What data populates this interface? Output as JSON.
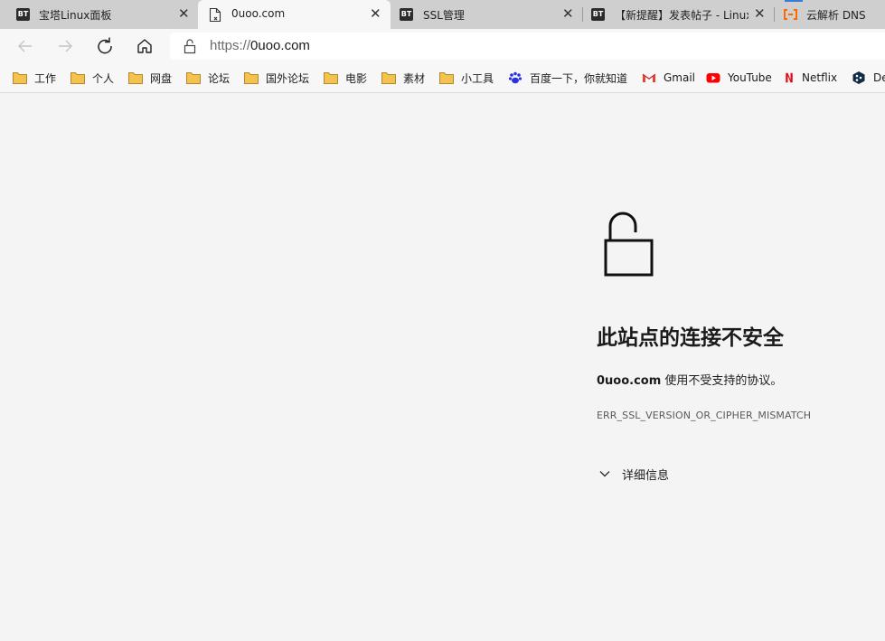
{
  "tabs": [
    {
      "favicon": "BT",
      "title": "宝塔Linux面板",
      "close": "✕"
    },
    {
      "favicon_icon": "broken-page-icon",
      "title": "0uoo.com",
      "close": "✕"
    },
    {
      "favicon": "BT",
      "title": "SSL管理",
      "close": "✕"
    },
    {
      "favicon": "BT",
      "title": "【新提醒】发表帖子 - Linux",
      "close": "✕"
    },
    {
      "favicon_icon": "aliyun-cloud-icon",
      "title": "云解析 DNS"
    }
  ],
  "toolbar": {
    "back_icon": "arrow-left-icon",
    "forward_icon": "arrow-right-icon",
    "refresh_icon": "refresh-icon",
    "home_icon": "home-icon"
  },
  "address_bar": {
    "lock_icon": "unlocked-padlock-icon",
    "url_protocol": "https://",
    "url_host": "0uoo.com"
  },
  "bookmarks": [
    {
      "label": "工作",
      "icon": "folder-icon"
    },
    {
      "label": "个人",
      "icon": "folder-icon"
    },
    {
      "label": "网盘",
      "icon": "folder-icon"
    },
    {
      "label": "论坛",
      "icon": "folder-icon"
    },
    {
      "label": "国外论坛",
      "icon": "folder-icon"
    },
    {
      "label": "电影",
      "icon": "folder-icon"
    },
    {
      "label": "素材",
      "icon": "folder-icon"
    },
    {
      "label": "小工具",
      "icon": "folder-icon"
    },
    {
      "label": "百度一下，你就知道",
      "icon": "baidu-paw-icon"
    },
    {
      "label": "Gmail",
      "icon": "gmail-icon"
    },
    {
      "label": "YouTube",
      "icon": "youtube-icon"
    },
    {
      "label": "Netflix",
      "icon": "netflix-icon"
    },
    {
      "label": "De",
      "icon": "deepl-icon"
    }
  ],
  "error": {
    "icon": "open-padlock-icon",
    "title": "此站点的连接不安全",
    "host": "0uoo.com",
    "message": " 使用不受支持的协议。",
    "code": "ERR_SSL_VERSION_OR_CIPHER_MISMATCH",
    "details_label": "详细信息",
    "details_icon": "chevron-down-icon"
  },
  "colors": {
    "page_background": "#f4f4f4",
    "tabstrip_background": "#cfcfcf",
    "folder_yellow": "#f2c34e",
    "youtube_red": "#ff0000",
    "netflix_red": "#e50914",
    "baidu_blue": "#2932e1",
    "aliyun_orange": "#ff6a00"
  }
}
